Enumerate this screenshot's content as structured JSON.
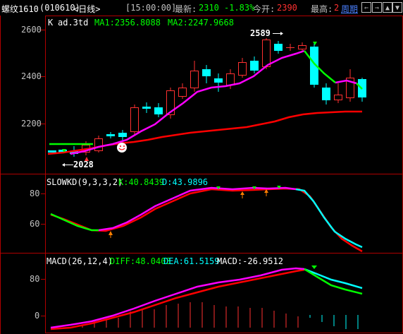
{
  "header": {
    "symbol": "螺纹1610",
    "code": "(010610)",
    "period": "<日线>",
    "time": "[15:00:00]",
    "latest_label": "最新:",
    "latest_value": "2310",
    "change_pct": "-1.83%",
    "today_open_label": "今开:",
    "today_open_value": "2390",
    "high_label": "最高:",
    "high_value": "2",
    "cycle_btn": "周期",
    "nav_buttons": [
      "⇐",
      "⇒",
      "▲",
      "▼"
    ]
  },
  "main_panel": {
    "indicator_label": "K",
    "subtitle": "ad.3td",
    "ma1_label": "MA1:2356.8088",
    "ma2_label": "MA2:2247.9668",
    "y_ticks": [
      "2600",
      "2400",
      "2200"
    ],
    "annot_high": "2589",
    "annot_low": "2028",
    "colors": {
      "up": "#ff3030",
      "down": "#00ffff",
      "ma1": "#ff00ff",
      "ma2": "#ff0000",
      "green": "#00ff00"
    }
  },
  "kd_panel": {
    "title": "SLOWKD(9,3,3,2)",
    "k_label": "K:40.8439",
    "d_label": "D:43.9896",
    "y_ticks": [
      "80",
      "60"
    ]
  },
  "macd_panel": {
    "title": "MACD(26,12,4)",
    "diff_label": "DIFF:48.0403",
    "dea_label": "DEA:61.5159",
    "macd_label": "MACD:-26.9512",
    "y_ticks": [
      "80",
      "0"
    ]
  }
}
